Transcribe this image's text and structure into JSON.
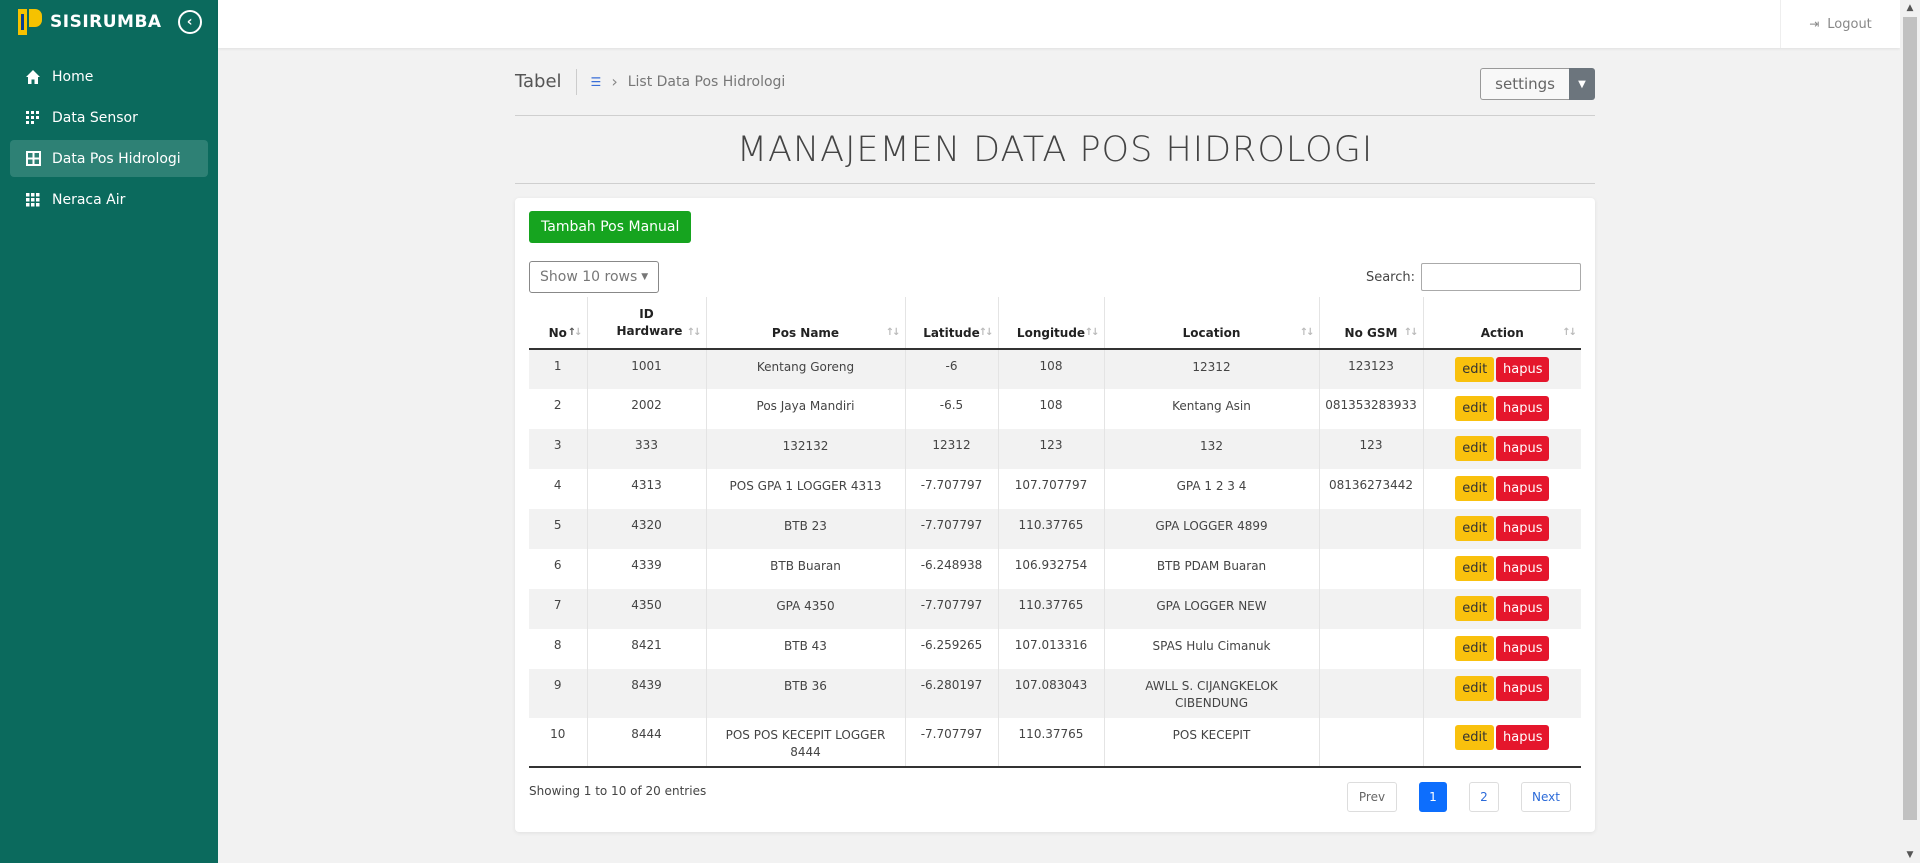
{
  "brand": {
    "name": "SISIRUMBA"
  },
  "sidebar": {
    "items": [
      {
        "label": "Home",
        "icon": "home-icon",
        "active": false
      },
      {
        "label": "Data Sensor",
        "icon": "sensor-grid-icon",
        "active": false
      },
      {
        "label": "Data Pos Hidrologi",
        "icon": "table-icon",
        "active": true
      },
      {
        "label": "Neraca Air",
        "icon": "grid-icon",
        "active": false
      }
    ]
  },
  "topbar": {
    "logout_label": "Logout"
  },
  "breadcrumb": {
    "tab": "Tabel",
    "current": "List Data Pos Hidrologi"
  },
  "settings": {
    "label": "settings"
  },
  "page": {
    "title": "MANAJEMEN DATA POS HIDROLOGI"
  },
  "card": {
    "add_button": "Tambah Pos Manual",
    "show_rows": "Show 10 rows",
    "search_label": "Search:",
    "search_value": ""
  },
  "table": {
    "columns": [
      "No",
      "ID Hardware",
      "Pos Name",
      "Latitude",
      "Longitude",
      "Location",
      "No GSM",
      "Action"
    ],
    "rows": [
      {
        "no": "1",
        "id": "1001",
        "name": "Kentang Goreng",
        "lat": "-6",
        "lon": "108",
        "loc": "12312",
        "gsm": "123123"
      },
      {
        "no": "2",
        "id": "2002",
        "name": "Pos Jaya Mandiri",
        "lat": "-6.5",
        "lon": "108",
        "loc": "Kentang Asin",
        "gsm": "081353283933"
      },
      {
        "no": "3",
        "id": "333",
        "name": "132132",
        "lat": "12312",
        "lon": "123",
        "loc": "132",
        "gsm": "123"
      },
      {
        "no": "4",
        "id": "4313",
        "name": "POS GPA 1 LOGGER 4313",
        "lat": "-7.707797",
        "lon": "107.707797",
        "loc": "GPA 1 2 3 4",
        "gsm": "08136273442"
      },
      {
        "no": "5",
        "id": "4320",
        "name": "BTB 23",
        "lat": "-7.707797",
        "lon": "110.37765",
        "loc": "GPA LOGGER 4899",
        "gsm": ""
      },
      {
        "no": "6",
        "id": "4339",
        "name": "BTB Buaran",
        "lat": "-6.248938",
        "lon": "106.932754",
        "loc": "BTB PDAM Buaran",
        "gsm": ""
      },
      {
        "no": "7",
        "id": "4350",
        "name": "GPA 4350",
        "lat": "-7.707797",
        "lon": "110.37765",
        "loc": "GPA LOGGER NEW",
        "gsm": ""
      },
      {
        "no": "8",
        "id": "8421",
        "name": "BTB 43",
        "lat": "-6.259265",
        "lon": "107.013316",
        "loc": "SPAS Hulu Cimanuk",
        "gsm": ""
      },
      {
        "no": "9",
        "id": "8439",
        "name": "BTB 36",
        "lat": "-6.280197",
        "lon": "107.083043",
        "loc": "AWLL S. CIJANGKELOK CIBENDUNG",
        "gsm": ""
      },
      {
        "no": "10",
        "id": "8444",
        "name": "POS POS KECEPIT LOGGER 8444",
        "lat": "-7.707797",
        "lon": "110.37765",
        "loc": "POS KECEPIT",
        "gsm": ""
      }
    ],
    "edit_label": "edit",
    "delete_label": "hapus"
  },
  "footer": {
    "info": "Showing 1 to 10 of 20 entries",
    "prev": "Prev",
    "pages": [
      "1",
      "2"
    ],
    "current_page": "1",
    "next": "Next"
  },
  "colors": {
    "sidebar": "#0b6a5d",
    "sidebar_active": "#2e8175",
    "add_button": "#16a41f",
    "edit_button": "#f9c10d",
    "delete_button": "#e5162c",
    "active_page": "#0d6efd"
  }
}
